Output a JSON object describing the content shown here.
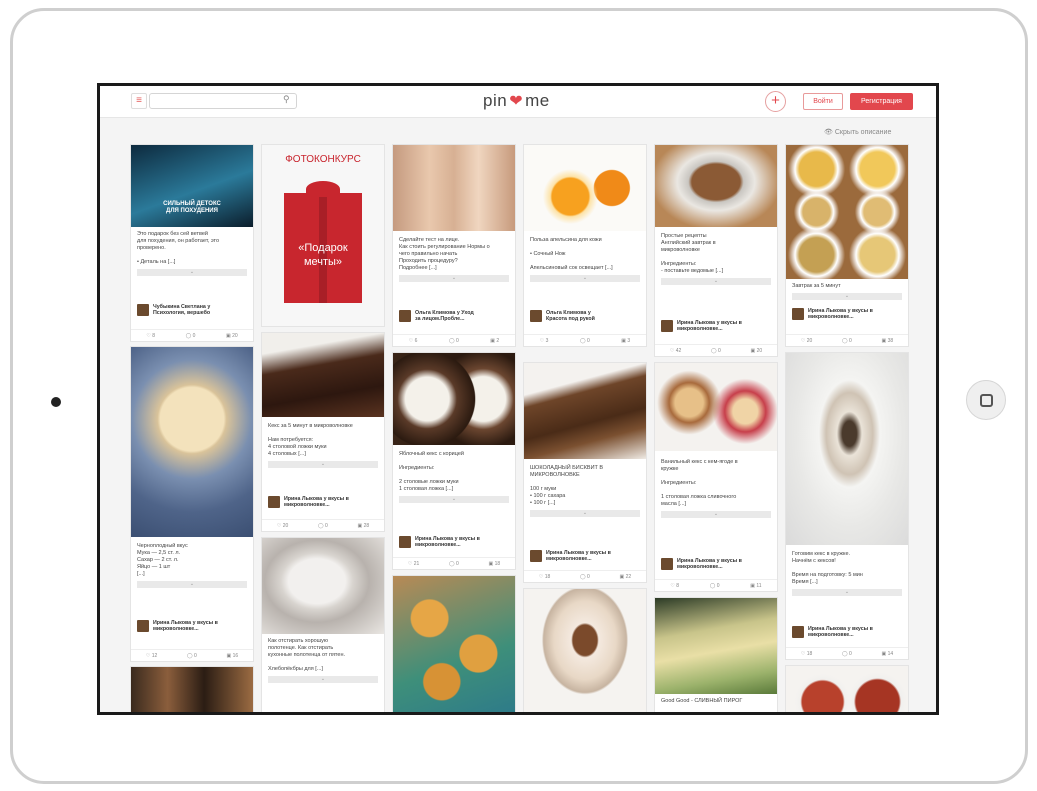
{
  "header": {
    "menu_icon": "hamburger-icon",
    "search_placeholder": "",
    "search_icon": "magnifier-icon",
    "logo_left": "pin",
    "logo_heart": "❤",
    "logo_right": "me",
    "add_icon": "plus-icon",
    "login_label": "Войти",
    "register_label": "Регистрация"
  },
  "hide_descriptions": "Скрыть описание",
  "colors": {
    "accent": "#e2474d"
  },
  "cards": [
    {
      "caption": "Это подарок без сей ветвей\nдля похудения, он работает, это\nпроверено.\n\n• Деталь на [...]",
      "author": "Чубыкина Светлана у\nПсихология, вершебо",
      "stats": [
        "8",
        "0",
        "20"
      ],
      "overlay": "СИЛЬНЫЙ ДЕТОКС\nДЛЯ ПОХУДЕНИЯ"
    },
    {
      "caption": "",
      "author": "",
      "stats": [],
      "overlay": "ФОТОКОНКУРС",
      "gift_text": "«Подарок\nмечты»"
    },
    {
      "caption": "Сделайте тест на лице.\nКак стоить регулирование Нормы о\nчего правильно начать\nПроходить процедуру?\nПодробнее [...]",
      "author": "Ольга Климова у Уход\nза лицом.Пробле...",
      "stats": [
        "6",
        "0",
        "2"
      ]
    },
    {
      "caption": "Польза апельсина для кожи\n\n• Сочный Нож\n\nАпельсиновый сок освещает [...]",
      "author": "Ольга Климова у\nКрасота под рукой",
      "stats": [
        "3",
        "0",
        "3"
      ]
    },
    {
      "caption": "Простые рецепты\nАнглийский завтрак в\nмикроволновке\n\nИнгредиенты:\n- поставьте ведомые [...]",
      "author": "Ирина Лыкова у вкусы в\nмикроволновке...",
      "stats": [
        "42",
        "0",
        "20"
      ]
    },
    {
      "caption": "Завтрак за 5 минут",
      "author": "Ирина Лыкова у вкусы в\nмикроволновке...",
      "stats": [
        "20",
        "0",
        "38"
      ]
    },
    {
      "caption": "Черноплодный вкус\nМука — 2,5 ст. л.\nСахар — 2 ст. л.\nЯйцо — 1 шт\n[...]",
      "author": "Ирина Лыкова у вкусы в\nмикроволновке...",
      "stats": [
        "12",
        "0",
        "16"
      ]
    },
    {
      "caption": "Кекс за 5 минут в микроволновке\n\nНам потребуется:\n4 столовой ложки муки\n4 столовых [...]",
      "author": "Ирина Лыкова у вкусы в\nмикроволновке...",
      "stats": [
        "20",
        "0",
        "28"
      ]
    },
    {
      "caption": "Яблочный кекс с корицей\n\nИнгредиенты:\n\n2 столовые ложки муки\n1 столовая ложка [...]",
      "author": "Ирина Лыкова у вкусы в\nмикроволновке...",
      "stats": [
        "21",
        "0",
        "18"
      ]
    },
    {
      "caption": "ШОКОЛАДНЫЙ БИСКВИТ В\nМИКРОВОЛНОВКЕ\n\n100 г муки\n• 100 г сахара\n• 100 г [...]",
      "author": "Ирина Лыкова у вкусы в\nмикроволновке...",
      "stats": [
        "18",
        "0",
        "22"
      ]
    },
    {
      "caption": "Ванильный кекс с кем-ягоде в\nкружке\n\nИнгредиенты:\n\n1 столовая ложка сливочного\nмасла [...]",
      "author": "Ирина Лыкова у вкусы в\nмикроволновке...",
      "stats": [
        "8",
        "0",
        "11"
      ]
    },
    {
      "caption": "Готовим кекс в кружке.\nНачнём с кексов!\n\nВремя на подготовку: 5 мин\nВремя [...]",
      "author": "Ирина Лыкова у вкусы в\nмикроволновке...",
      "stats": [
        "18",
        "0",
        "14"
      ]
    },
    {
      "caption": "Как отстирать хорошую\nполотенце. Как отстирать\nкухонные полотенца от пятен.\n\nХлебопёкбры для [...]",
      "author": "",
      "stats": []
    },
    {
      "caption": "Good Good - СЛИВНЫЙ ПИРОГ",
      "author": "",
      "stats": []
    }
  ]
}
